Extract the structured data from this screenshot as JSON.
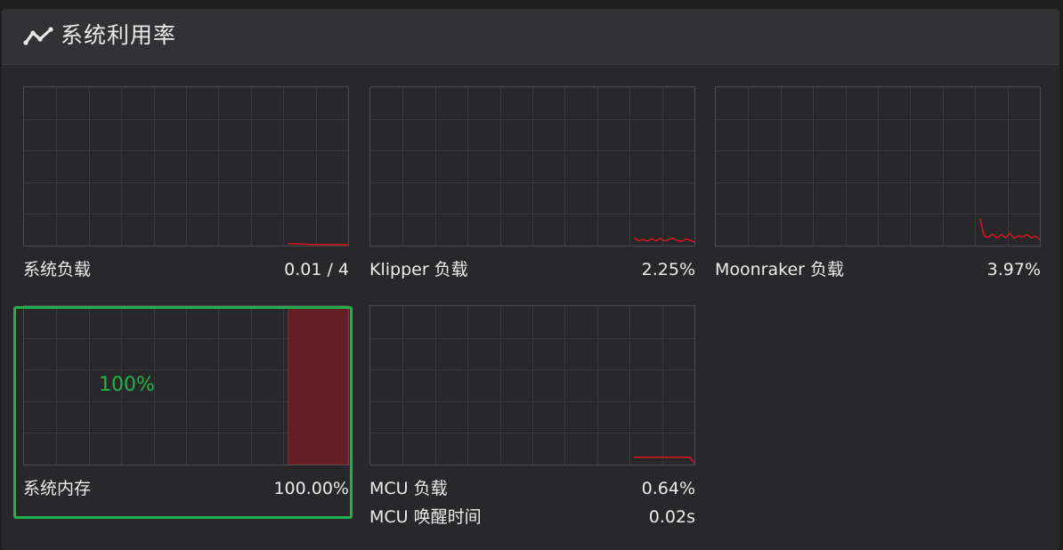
{
  "header": {
    "title": "系统利用率",
    "icon": "line-chart-icon"
  },
  "colors": {
    "accent_red": "#e3141e",
    "memory_fill": "#6b1e23",
    "highlight_green": "#21b14b",
    "grid": "#3a3a3d"
  },
  "tiles": [
    {
      "id": "system-load",
      "label": "系统负载",
      "value": "0.01 / 4",
      "chart_type": "line"
    },
    {
      "id": "klipper-load",
      "label": "Klipper 负载",
      "value": "2.25%",
      "chart_type": "line"
    },
    {
      "id": "moonraker-load",
      "label": "Moonraker 负载",
      "value": "3.97%",
      "chart_type": "line"
    },
    {
      "id": "system-memory",
      "label": "系统内存",
      "value": "100.00%",
      "overlay": "100%",
      "chart_type": "area",
      "highlighted": true
    },
    {
      "id": "mcu-load",
      "label": "MCU 负载",
      "value": "0.64%",
      "extra_label": "MCU 唤醒时间",
      "extra_value": "0.02s",
      "chart_type": "line"
    }
  ],
  "chart_data": [
    {
      "type": "line",
      "id": "system-load",
      "values": [
        0.05,
        0.05,
        0.05,
        0.04,
        0.04,
        0.03,
        0.03,
        0.02,
        0.02,
        0.02,
        0.01,
        0.01,
        0.01,
        0.01,
        0.01
      ],
      "ylim": [
        0,
        4
      ]
    },
    {
      "type": "line",
      "id": "klipper-load",
      "values": [
        4.8,
        3.1,
        3.9,
        2.8,
        4.4,
        3.0,
        4.6,
        2.9,
        3.7,
        4.9,
        3.2,
        2.7,
        4.1,
        3.4,
        2.25
      ],
      "ylim": [
        0,
        100
      ]
    },
    {
      "type": "line",
      "id": "moonraker-load",
      "values": [
        17.0,
        6.1,
        5.2,
        7.4,
        4.8,
        6.9,
        5.0,
        7.7,
        4.6,
        6.3,
        5.4,
        7.1,
        4.9,
        6.0,
        3.97
      ],
      "ylim": [
        0,
        100
      ]
    },
    {
      "type": "area",
      "id": "system-memory",
      "values": [
        100,
        100,
        100,
        100,
        100,
        100,
        100,
        100,
        100,
        100,
        100,
        100,
        100,
        100,
        100
      ],
      "ylim": [
        0,
        100
      ]
    },
    {
      "type": "line",
      "id": "mcu-load",
      "values": [
        4.6,
        4.6,
        4.6,
        4.6,
        4.6,
        4.6,
        4.6,
        4.6,
        4.6,
        4.6,
        4.6,
        4.6,
        4.6,
        4.6,
        0.64
      ],
      "ylim": [
        0,
        100
      ]
    }
  ]
}
